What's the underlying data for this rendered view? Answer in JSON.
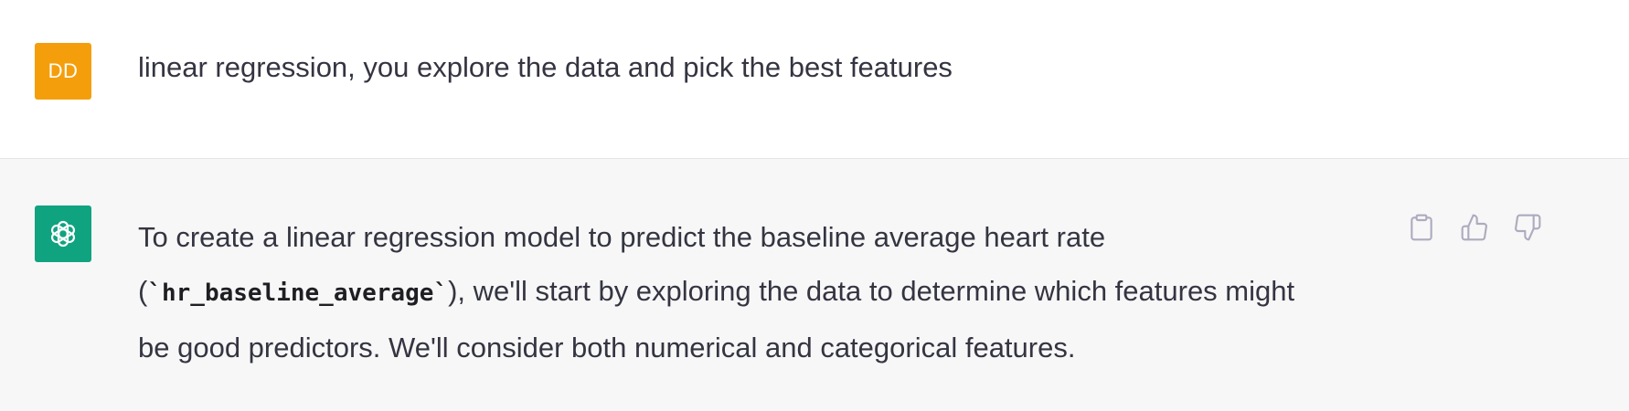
{
  "user_message": {
    "avatar_initials": "DD",
    "avatar_color": "#f59e0b",
    "text": "linear regression, you explore the data and pick the best features"
  },
  "assistant_message": {
    "avatar_color": "#10a37f",
    "avatar_icon": "openai-logo-icon",
    "text_before_code": "To create a linear regression model to predict the baseline average heart rate (",
    "code": "`hr_baseline_average`",
    "text_after_code": "), we'll start by exploring the data to determine which features might be good predictors. We'll consider both numerical and categorical features.",
    "actions": [
      "clipboard-icon",
      "thumbs-up-icon",
      "thumbs-down-icon"
    ]
  },
  "colors": {
    "user_row_bg": "#ffffff",
    "assistant_row_bg": "#f7f7f8",
    "text": "#343541",
    "icon_gray": "#acacbe"
  }
}
